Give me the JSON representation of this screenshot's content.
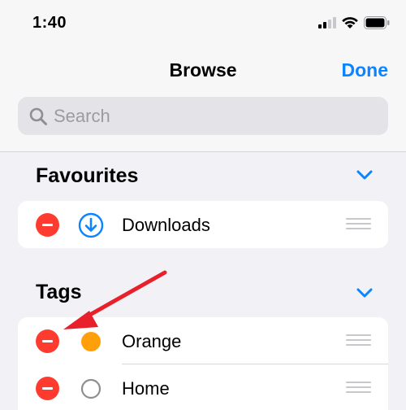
{
  "status_bar": {
    "time": "1:40",
    "icons": [
      "cellular-signal-icon",
      "wifi-icon",
      "battery-icon"
    ]
  },
  "nav": {
    "title": "Browse",
    "done_label": "Done"
  },
  "search": {
    "placeholder": "Search",
    "value": ""
  },
  "favourites": {
    "header": "Favourites",
    "items": [
      {
        "label": "Downloads",
        "icon": "download-circle-icon"
      }
    ]
  },
  "tags": {
    "header": "Tags",
    "items": [
      {
        "label": "Orange",
        "icon": "orange-tag-dot-icon",
        "color": "#ff9f0a"
      },
      {
        "label": "Home",
        "icon": "empty-tag-circle-icon",
        "color": "#8e8e93"
      }
    ]
  },
  "colors": {
    "accent": "#0a84ff",
    "delete": "#ff3b30",
    "annotation_arrow": "#e8202c"
  }
}
